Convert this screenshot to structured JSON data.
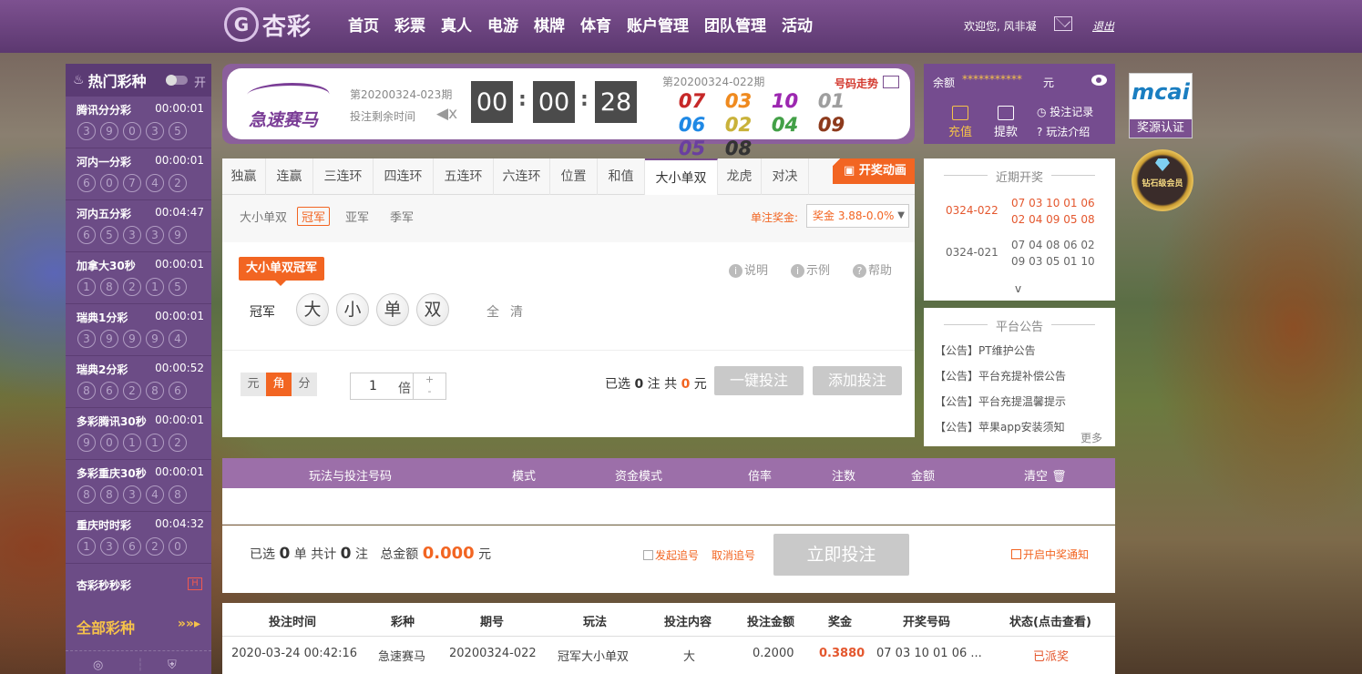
{
  "header": {
    "logo_mark": "G",
    "logo_text": "杏彩",
    "nav": [
      "首页",
      "彩票",
      "真人",
      "电游",
      "棋牌",
      "体育",
      "账户管理",
      "团队管理",
      "活动"
    ],
    "welcome": "欢迎您, 风非凝",
    "logout": "退出"
  },
  "sidebar": {
    "title": "热门彩种",
    "toggle_label": "开",
    "lotteries": [
      {
        "name": "腾讯分分彩",
        "time": "00:00:01",
        "balls": [
          "3",
          "9",
          "0",
          "3",
          "5"
        ]
      },
      {
        "name": "河内一分彩",
        "time": "00:00:01",
        "balls": [
          "6",
          "0",
          "7",
          "4",
          "2"
        ]
      },
      {
        "name": "河内五分彩",
        "time": "00:04:47",
        "balls": [
          "6",
          "5",
          "3",
          "3",
          "9"
        ]
      },
      {
        "name": "加拿大30秒",
        "time": "00:00:01",
        "balls": [
          "1",
          "8",
          "2",
          "1",
          "5"
        ]
      },
      {
        "name": "瑞典1分彩",
        "time": "00:00:01",
        "balls": [
          "3",
          "9",
          "9",
          "9",
          "4"
        ]
      },
      {
        "name": "瑞典2分彩",
        "time": "00:00:52",
        "balls": [
          "8",
          "6",
          "2",
          "8",
          "6"
        ]
      },
      {
        "name": "多彩腾讯30秒",
        "time": "00:00:01",
        "balls": [
          "9",
          "0",
          "1",
          "1",
          "2"
        ]
      },
      {
        "name": "多彩重庆30秒",
        "time": "00:00:01",
        "balls": [
          "8",
          "8",
          "3",
          "4",
          "8"
        ]
      },
      {
        "name": "重庆时时彩",
        "time": "00:04:32",
        "balls": [
          "1",
          "3",
          "6",
          "2",
          "0"
        ]
      }
    ],
    "xc_name": "杏彩秒秒彩",
    "xc_badge": "H",
    "all_label": "全部彩种",
    "all_arrow": "»»▸"
  },
  "timer": {
    "game_name": "急速赛马",
    "current_issue": "第20200324-023期",
    "remain_label": "投注剩余时间",
    "mute_glyph": "◀x",
    "hours": "00",
    "minutes": "00",
    "seconds": "28",
    "prev_issue": "第20200324-022期",
    "trend_label": "号码走势",
    "numbers": [
      {
        "v": "07",
        "c": "#c62828"
      },
      {
        "v": "03",
        "c": "#ef8a1f"
      },
      {
        "v": "10",
        "c": "#9c27b0"
      },
      {
        "v": "01",
        "c": "#9e9e9e"
      },
      {
        "v": "06",
        "c": "#1e88e5"
      },
      {
        "v": "02",
        "c": "#c9b23a"
      },
      {
        "v": "04",
        "c": "#43a047"
      },
      {
        "v": "09",
        "c": "#8d3a1c"
      },
      {
        "v": "05",
        "c": "#6a3fa0"
      },
      {
        "v": "08",
        "c": "#333333"
      }
    ]
  },
  "account": {
    "balance_label": "余额",
    "balance_value": "***********",
    "balance_unit": "元",
    "deposit": "充值",
    "withdraw": "提款",
    "bet_records": "投注记录",
    "rules": "玩法介绍"
  },
  "badges": {
    "mcai": "mcai",
    "award_label": "奖源认证",
    "diamond": "钻石级会员"
  },
  "play": {
    "tabs": [
      "独赢",
      "连赢",
      "三连环",
      "四连环",
      "五连环",
      "六连环",
      "位置",
      "和值",
      "大小单双",
      "龙虎",
      "对决"
    ],
    "active_tab": 8,
    "animation_btn": "开奖动画",
    "subtabs": [
      "大小单双",
      "冠军",
      "亚军",
      "季军"
    ],
    "active_subtab": 1,
    "prize_label": "单注奖金:",
    "prize_select": "奖金 3.88-0.0%",
    "method_badge": "大小单双冠军",
    "explain": "说明",
    "example": "示例",
    "help": "帮助",
    "row_label": "冠军",
    "picks": [
      "大",
      "小",
      "单",
      "双"
    ],
    "all": "全",
    "clear": "清",
    "modes": [
      "元",
      "角",
      "分"
    ],
    "active_mode": 1,
    "multiple": "1",
    "multiple_unit": "倍",
    "selected_prefix": "已选",
    "selected_count": "0",
    "selected_mid": "注  共",
    "selected_amount": "0",
    "selected_unit": "元",
    "one_click": "一键投注",
    "add_bet": "添加投注"
  },
  "recent": {
    "title": "近期开奖",
    "draws": [
      {
        "issue": "0324-022",
        "nums": "07 03 10 01 06 02 04 09 05 08",
        "color": "#e4572e"
      },
      {
        "issue": "0324-021",
        "nums": "07 04 08 06 02 09 03 05 01 10",
        "color": "#666666"
      }
    ],
    "more_glyph": "v"
  },
  "notice": {
    "title": "平台公告",
    "items": [
      "【公告】PT维护公告",
      "【公告】平台充提补偿公告",
      "【公告】平台充提温馨提示",
      "【公告】苹果app安装须知"
    ],
    "more": "更多"
  },
  "bet_list": {
    "headers": [
      "玩法与投注号码",
      "模式",
      "资金模式",
      "倍率",
      "注数",
      "金额",
      "清空 🗑"
    ]
  },
  "summary": {
    "sel": "已选",
    "orders": "0",
    "unit1": "单 共计",
    "notes": "0",
    "unit2": "注",
    "total_label": "总金额",
    "total": "0.000",
    "yuan": "元",
    "chase": "发起追号",
    "chase_cancel": "取消追号",
    "bet_now": "立即投注",
    "notify": "开启中奖通知"
  },
  "records": {
    "headers": [
      "投注时间",
      "彩种",
      "期号",
      "玩法",
      "投注内容",
      "投注金额",
      "奖金",
      "开奖号码",
      "状态(点击查看)"
    ],
    "row": [
      "2020-03-24 00:42:16",
      "急速赛马",
      "20200324-022",
      "冠军大小单双",
      "大",
      "0.2000",
      "0.3880",
      "07 03 10 01 06 ...",
      "已派奖"
    ]
  }
}
